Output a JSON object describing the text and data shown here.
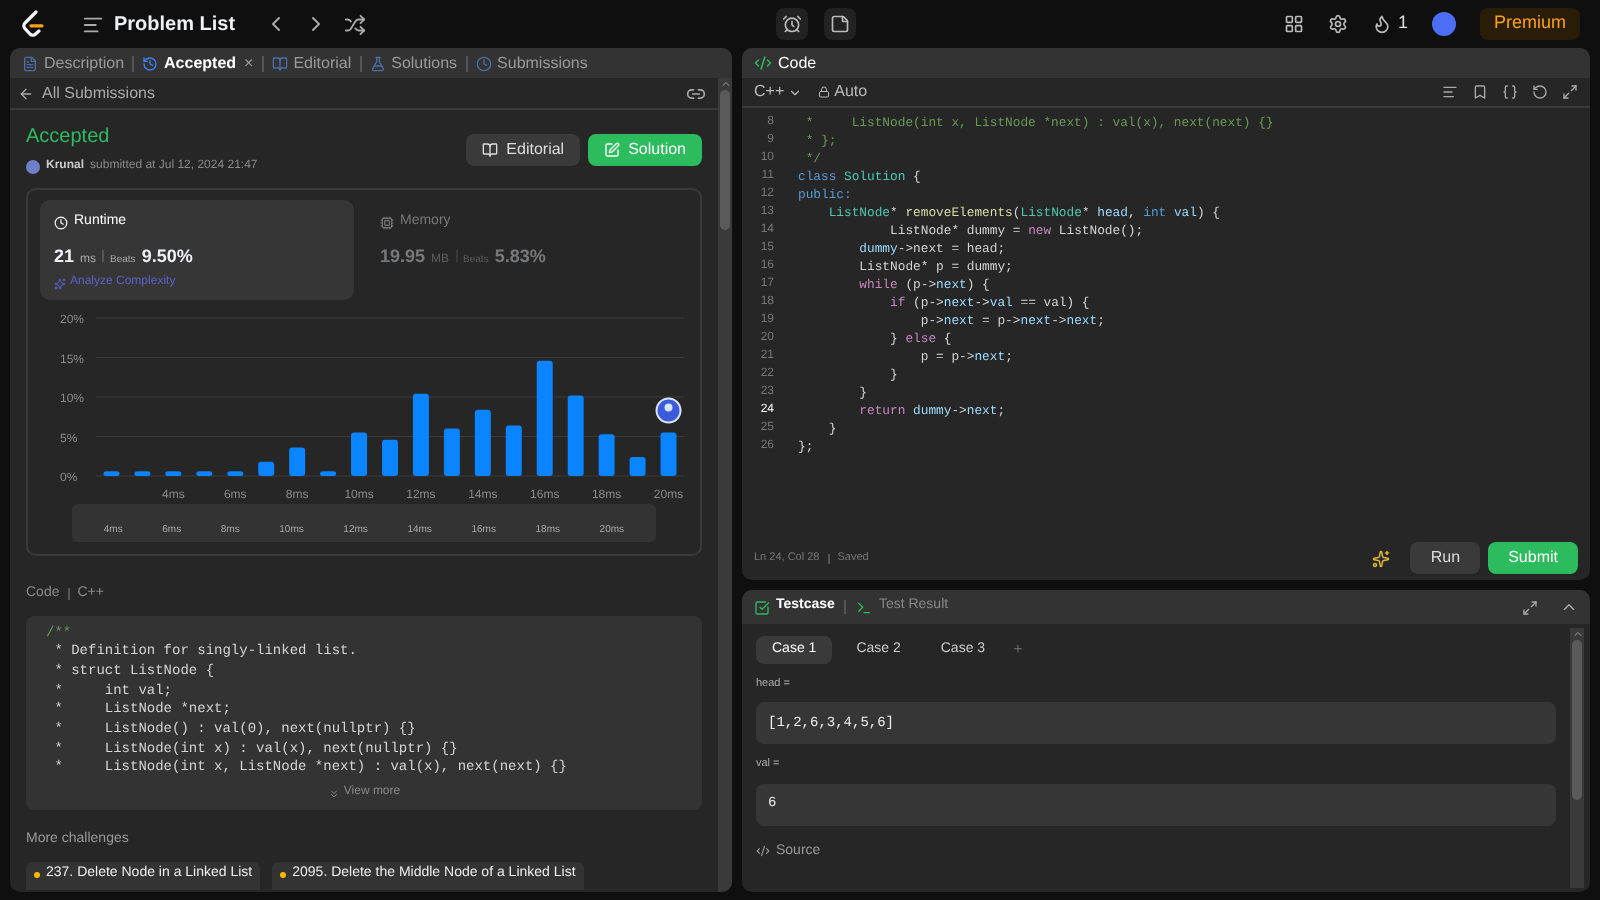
{
  "topbar": {
    "title": "Problem List",
    "streak": "1",
    "premium": "Premium"
  },
  "left_tabs": [
    {
      "label": "Description",
      "selected": false
    },
    {
      "label": "Accepted",
      "selected": true,
      "close": "×"
    },
    {
      "label": "Editorial",
      "selected": false
    },
    {
      "label": "Solutions",
      "selected": false
    },
    {
      "label": "Submissions",
      "selected": false
    }
  ],
  "back_link": "All Submissions",
  "submission": {
    "status": "Accepted",
    "user": "Krunal",
    "submitted": "submitted at Jul 12, 2024 21:47",
    "buttons": [
      {
        "label": "Editorial",
        "kind": "secondary"
      },
      {
        "label": "Solution",
        "kind": "primary"
      }
    ]
  },
  "stats": [
    {
      "title": "Runtime",
      "selected": true,
      "value": "21",
      "unit": "ms",
      "beats_label": "Beats",
      "beats": "9.50%",
      "link": "Analyze Complexity"
    },
    {
      "title": "Memory",
      "selected": false,
      "value": "19.95",
      "unit": "MB",
      "beats_label": "Beats",
      "beats": "5.83%"
    }
  ],
  "chart_data": {
    "type": "bar",
    "x": [
      2,
      3,
      4,
      5,
      6,
      7,
      8,
      9,
      10,
      11,
      12,
      13,
      14,
      15,
      16,
      17,
      18,
      19,
      20
    ],
    "series": [
      {
        "color": "#0a84ff",
        "values": [
          0.6,
          0.6,
          0.6,
          0.6,
          0.6,
          1.8,
          3.6,
          0.6,
          5.5,
          4.6,
          10.4,
          6,
          8.4,
          6.4,
          14.6,
          10.2,
          5.3,
          2.4,
          5.5
        ]
      }
    ],
    "xlim": [
      1.5,
      20.5
    ],
    "xticks": [
      {
        "value": 4,
        "label": "4ms"
      },
      {
        "value": 6,
        "label": "6ms"
      },
      {
        "value": 8,
        "label": "8ms"
      },
      {
        "value": 10,
        "label": "10ms"
      },
      {
        "value": 12,
        "label": "12ms"
      },
      {
        "value": 14,
        "label": "14ms"
      },
      {
        "value": 16,
        "label": "16ms"
      },
      {
        "value": 18,
        "label": "18ms"
      },
      {
        "value": 20,
        "label": "20ms"
      }
    ],
    "yticks": [
      {
        "value": 0,
        "label": "0%"
      },
      {
        "value": 5,
        "label": "5%"
      },
      {
        "value": 10,
        "label": "10%"
      },
      {
        "value": 15,
        "label": "15%"
      },
      {
        "value": 20,
        "label": "20%"
      }
    ],
    "ylim": [
      0,
      20
    ],
    "grid": true
  },
  "navigator_labels": [
    "4ms",
    "6ms",
    "8ms",
    "10ms",
    "12ms",
    "14ms",
    "16ms",
    "18ms",
    "20ms"
  ],
  "code_section": {
    "label": "Code",
    "language": "C++",
    "view_more": "View more",
    "lines": [
      {
        "text": "/**",
        "kind": "marker"
      },
      {
        "text": " * Definition for singly-linked list.",
        "kind": "text"
      },
      {
        "text": " * struct ListNode {",
        "kind": "text"
      },
      {
        "text": " *     int val;",
        "kind": "text"
      },
      {
        "text": " *     ListNode *next;",
        "kind": "text"
      },
      {
        "text": " *     ListNode() : val(0), next(nullptr) {}",
        "kind": "text"
      },
      {
        "text": " *     ListNode(int x) : val(x), next(nullptr) {}",
        "kind": "text"
      },
      {
        "text": " *     ListNode(int x, ListNode *next) : val(x), next(next) {}",
        "kind": "text"
      }
    ]
  },
  "more_challenges": {
    "title": "More challenges",
    "items": [
      {
        "label": "237. Delete Node in a Linked List",
        "color": "#ffb800"
      },
      {
        "label": "2095. Delete the Middle Node of a Linked List",
        "color": "#ffb800"
      }
    ]
  },
  "editor": {
    "title": "Code",
    "language": "C++",
    "mode": "Auto",
    "status": "Ln 24, Col 28",
    "saved": "Saved",
    "run": "Run",
    "submit": "Submit",
    "lines": [
      {
        "num": "8",
        "current": false,
        "t": [
          {
            "text": " *     ListNode(int x, ListNode *next) : val(x), next(next) {}",
            "kind": "comment"
          }
        ]
      },
      {
        "num": "9",
        "current": false,
        "t": [
          {
            "text": " * };",
            "kind": "comment"
          }
        ]
      },
      {
        "num": "10",
        "current": false,
        "t": [
          {
            "text": " */",
            "kind": "comment"
          }
        ]
      },
      {
        "num": "11",
        "current": false,
        "t": [
          {
            "text": "class ",
            "kind": "keyword"
          },
          {
            "text": "Solution",
            "kind": "type"
          },
          {
            "text": " {",
            "kind": "plain"
          }
        ]
      },
      {
        "num": "12",
        "current": false,
        "t": [
          {
            "text": "public:",
            "kind": "keyword"
          }
        ]
      },
      {
        "num": "13",
        "current": false,
        "t": [
          {
            "text": "    ListNode",
            "kind": "type"
          },
          {
            "text": "* ",
            "kind": "plain"
          },
          {
            "text": "removeElements",
            "kind": "function"
          },
          {
            "text": "(",
            "kind": "plain"
          },
          {
            "text": "ListNode",
            "kind": "type"
          },
          {
            "text": "* ",
            "kind": "plain"
          },
          {
            "text": "head",
            "kind": "variable"
          },
          {
            "text": ", ",
            "kind": "plain"
          },
          {
            "text": "int ",
            "kind": "keyword"
          },
          {
            "text": "val",
            "kind": "variable"
          },
          {
            "text": ") {",
            "kind": "plain"
          }
        ]
      },
      {
        "num": "14",
        "current": false,
        "t": [
          {
            "text": "            ListNode* dummy = ",
            "kind": "plain"
          },
          {
            "text": "new ",
            "kind": "control"
          },
          {
            "text": "ListNode();",
            "kind": "plain"
          }
        ]
      },
      {
        "num": "15",
        "current": false,
        "t": [
          {
            "text": "        dummy",
            "kind": "variable"
          },
          {
            "text": "->next = head;",
            "kind": "plain"
          }
        ]
      },
      {
        "num": "16",
        "current": false,
        "t": [
          {
            "text": "        ListNode* p = dummy;",
            "kind": "plain"
          }
        ]
      },
      {
        "num": "17",
        "current": false,
        "t": [
          {
            "text": "        while ",
            "kind": "control"
          },
          {
            "text": "(p->",
            "kind": "plain"
          },
          {
            "text": "next",
            "kind": "variable"
          },
          {
            "text": ") {",
            "kind": "plain"
          }
        ]
      },
      {
        "num": "18",
        "current": false,
        "t": [
          {
            "text": "            if ",
            "kind": "control"
          },
          {
            "text": "(p->",
            "kind": "plain"
          },
          {
            "text": "next",
            "kind": "variable"
          },
          {
            "text": "->",
            "kind": "plain"
          },
          {
            "text": "val",
            "kind": "variable"
          },
          {
            "text": " == val) {",
            "kind": "plain"
          }
        ]
      },
      {
        "num": "19",
        "current": false,
        "t": [
          {
            "text": "                p->",
            "kind": "plain"
          },
          {
            "text": "next",
            "kind": "variable"
          },
          {
            "text": " = p->",
            "kind": "plain"
          },
          {
            "text": "next",
            "kind": "variable"
          },
          {
            "text": "->",
            "kind": "plain"
          },
          {
            "text": "next",
            "kind": "variable"
          },
          {
            "text": ";",
            "kind": "plain"
          }
        ]
      },
      {
        "num": "20",
        "current": false,
        "t": [
          {
            "text": "            } ",
            "kind": "plain"
          },
          {
            "text": "else ",
            "kind": "control"
          },
          {
            "text": "{",
            "kind": "plain"
          }
        ]
      },
      {
        "num": "21",
        "current": false,
        "t": [
          {
            "text": "                p = p->",
            "kind": "plain"
          },
          {
            "text": "next",
            "kind": "variable"
          },
          {
            "text": ";",
            "kind": "plain"
          }
        ]
      },
      {
        "num": "22",
        "current": false,
        "t": [
          {
            "text": "            }",
            "kind": "plain"
          }
        ]
      },
      {
        "num": "23",
        "current": false,
        "t": [
          {
            "text": "        }",
            "kind": "plain"
          }
        ]
      },
      {
        "num": "24",
        "current": true,
        "t": [
          {
            "text": "        return ",
            "kind": "control"
          },
          {
            "text": "dummy",
            "kind": "variable"
          },
          {
            "text": "->",
            "kind": "plain"
          },
          {
            "text": "next",
            "kind": "variable"
          },
          {
            "text": ";",
            "kind": "plain"
          }
        ]
      },
      {
        "num": "25",
        "current": false,
        "t": [
          {
            "text": "    }",
            "kind": "plain"
          }
        ]
      },
      {
        "num": "26",
        "current": false,
        "t": [
          {
            "text": "};",
            "kind": "plain"
          }
        ]
      }
    ]
  },
  "bottom_tabs": [
    {
      "label": "Testcase",
      "selected": true
    },
    {
      "label": "Test Result",
      "selected": false
    }
  ],
  "cases": [
    {
      "label": "Case 1",
      "selected": true
    },
    {
      "label": "Case 2",
      "selected": false
    },
    {
      "label": "Case 3",
      "selected": false
    }
  ],
  "add_case": "+",
  "inputs": [
    {
      "label": "head =",
      "value": "[1,2,6,3,4,5,6]"
    },
    {
      "label": "val =",
      "value": "6"
    }
  ],
  "source": "Source"
}
